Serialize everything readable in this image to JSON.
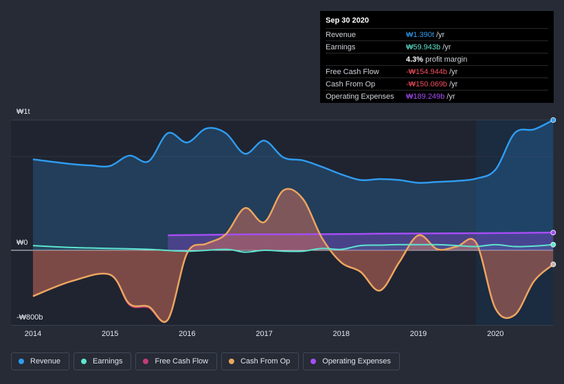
{
  "tooltip": {
    "date": "Sep 30 2020",
    "rows": [
      {
        "label": "Revenue",
        "value": "₩1.390t",
        "unit": "/yr",
        "color": "#2f9cf0"
      },
      {
        "label": "Earnings",
        "value": "₩59.943b",
        "unit": "/yr",
        "color": "#5ee6d0"
      },
      {
        "label": "",
        "value": "4.3%",
        "unit": "profit margin",
        "color": "#ffffff"
      },
      {
        "label": "Free Cash Flow",
        "value": "-₩154.944b",
        "unit": "/yr",
        "color": "#ef4d5c"
      },
      {
        "label": "Cash From Op",
        "value": "-₩150.069b",
        "unit": "/yr",
        "color": "#ef4d5c"
      },
      {
        "label": "Operating Expenses",
        "value": "₩189.249b",
        "unit": "/yr",
        "color": "#a64df5"
      }
    ]
  },
  "legend": [
    {
      "label": "Revenue",
      "color": "#2f9cf0"
    },
    {
      "label": "Earnings",
      "color": "#5ee6d0"
    },
    {
      "label": "Free Cash Flow",
      "color": "#c43a7a"
    },
    {
      "label": "Cash From Op",
      "color": "#e8a75e"
    },
    {
      "label": "Operating Expenses",
      "color": "#a64df5"
    }
  ],
  "chart_data": {
    "type": "line",
    "title": "",
    "xlabel": "",
    "ylabel": "",
    "x_ticks": [
      "2014",
      "2015",
      "2016",
      "2017",
      "2018",
      "2019",
      "2020"
    ],
    "y_tick_labels": [
      {
        "label": "₩1t",
        "value": 1390
      },
      {
        "label": "₩0",
        "value": 0
      },
      {
        "label": "-₩800b",
        "value": -800
      }
    ],
    "ylim": [
      -800,
      1390
    ],
    "xlim": [
      2013.85,
      2020.75
    ],
    "units": "₩ billions",
    "highlight_range": [
      2019.75,
      2020.75
    ],
    "series": [
      {
        "name": "Revenue",
        "color": "#2f9cf0",
        "x": [
          2014.0,
          2014.5,
          2014.75,
          2015.0,
          2015.25,
          2015.5,
          2015.75,
          2016.0,
          2016.25,
          2016.5,
          2016.75,
          2017.0,
          2017.25,
          2017.5,
          2017.75,
          2018.0,
          2018.25,
          2018.5,
          2018.75,
          2019.0,
          2019.25,
          2019.5,
          2019.75,
          2020.0,
          2020.25,
          2020.5,
          2020.75
        ],
        "y": [
          970,
          920,
          905,
          900,
          1010,
          950,
          1250,
          1150,
          1300,
          1250,
          1030,
          1170,
          990,
          960,
          890,
          810,
          750,
          760,
          750,
          720,
          730,
          740,
          765,
          860,
          1250,
          1290,
          1390
        ]
      },
      {
        "name": "Earnings",
        "color": "#5ee6d0",
        "x": [
          2014.0,
          2014.5,
          2015.0,
          2015.5,
          2016.0,
          2016.5,
          2016.75,
          2017.0,
          2017.25,
          2017.5,
          2017.75,
          2018.0,
          2018.25,
          2018.5,
          2018.75,
          2019.0,
          2019.25,
          2019.5,
          2019.75,
          2020.0,
          2020.25,
          2020.5,
          2020.75
        ],
        "y": [
          50,
          30,
          20,
          10,
          -10,
          10,
          -20,
          0,
          -10,
          -10,
          20,
          10,
          50,
          55,
          60,
          60,
          60,
          50,
          40,
          60,
          40,
          45,
          60
        ]
      },
      {
        "name": "Free Cash Flow",
        "color": "#c43a7a",
        "x": [
          2014.0,
          2014.5,
          2015.0,
          2015.25,
          2015.5,
          2015.75,
          2016.0,
          2016.25,
          2016.5,
          2016.75,
          2017.0,
          2017.25,
          2017.5,
          2017.75,
          2018.0,
          2018.25,
          2018.5,
          2018.75,
          2019.0,
          2019.25,
          2019.5,
          2019.75,
          2020.0,
          2020.25,
          2020.5,
          2020.75
        ],
        "y": [
          -490,
          -330,
          -260,
          -580,
          -610,
          -740,
          -30,
          70,
          170,
          450,
          300,
          640,
          550,
          130,
          -130,
          -230,
          -430,
          -130,
          160,
          10,
          40,
          80,
          -620,
          -690,
          -330,
          -150
        ]
      },
      {
        "name": "Cash From Op",
        "color": "#e8a75e",
        "x": [
          2014.0,
          2014.5,
          2015.0,
          2015.25,
          2015.5,
          2015.75,
          2016.0,
          2016.25,
          2016.5,
          2016.75,
          2017.0,
          2017.25,
          2017.5,
          2017.75,
          2018.0,
          2018.25,
          2018.5,
          2018.75,
          2019.0,
          2019.25,
          2019.5,
          2019.75,
          2020.0,
          2020.25,
          2020.5,
          2020.75
        ],
        "y": [
          -490,
          -330,
          -260,
          -570,
          -600,
          -740,
          -30,
          70,
          170,
          450,
          300,
          640,
          550,
          130,
          -130,
          -230,
          -430,
          -130,
          160,
          10,
          40,
          80,
          -620,
          -690,
          -330,
          -150
        ]
      },
      {
        "name": "Operating Expenses",
        "color": "#a64df5",
        "x": [
          2015.75,
          2016.25,
          2016.75,
          2017.25,
          2017.75,
          2018.25,
          2018.75,
          2019.25,
          2019.75,
          2020.25,
          2020.75
        ],
        "y": [
          160,
          165,
          170,
          170,
          172,
          175,
          178,
          180,
          182,
          185,
          189
        ]
      }
    ]
  }
}
